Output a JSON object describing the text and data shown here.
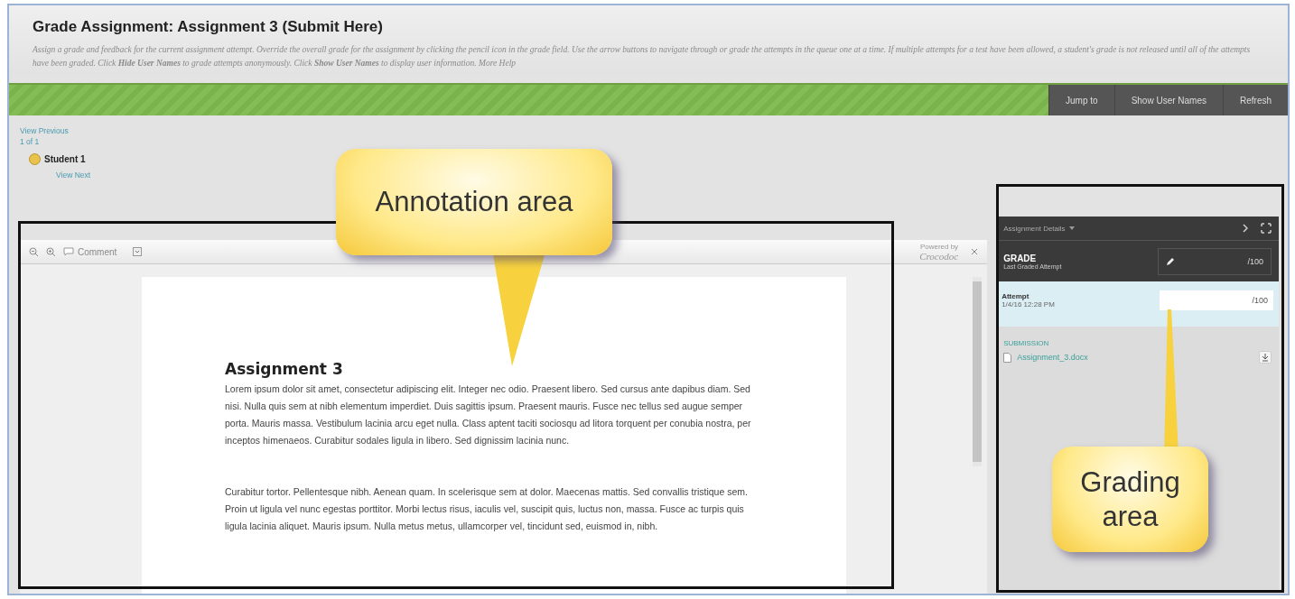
{
  "header": {
    "title": "Grade Assignment: Assignment 3 (Submit Here)",
    "description": "Assign a grade and feedback for the current assignment attempt. Override the overall grade for the assignment by clicking the pencil icon in the grade field. Use the arrow buttons to navigate through or grade the attempts in the queue one at a time. If multiple attempts for a test have been allowed, a student's grade is not released until all of the attempts have been graded. Click **Hide User Names** to grade attempts anonymously. Click **Show User Names** to display user information.",
    "help_link": "More Help"
  },
  "action_bar": {
    "buttons": [
      "Jump to",
      "Show User Names",
      "Refresh"
    ]
  },
  "student_nav": {
    "previous": "View Previous",
    "count": "1 of 1",
    "student": "Student 1",
    "next": "View Next"
  },
  "viewer": {
    "toolbar": {
      "comment": "Comment"
    },
    "branding": {
      "powered_by": "Powered by",
      "logo": "Crocodoc"
    },
    "document": {
      "heading": "Assignment 3",
      "paragraphs": [
        "Lorem ipsum dolor sit amet, consectetur adipiscing elit. Integer nec odio. Praesent libero. Sed cursus ante dapibus diam. Sed nisi. Nulla quis sem at nibh elementum imperdiet. Duis sagittis ipsum. Praesent mauris. Fusce nec tellus sed augue semper porta. Mauris massa. Vestibulum lacinia arcu eget nulla. Class aptent taciti sociosqu ad litora torquent per conubia nostra, per inceptos himenaeos. Curabitur sodales ligula in libero. Sed dignissim lacinia nunc.",
        "Curabitur tortor. Pellentesque nibh. Aenean quam. In scelerisque sem at dolor. Maecenas mattis. Sed convallis tristique sem. Proin ut ligula vel nunc egestas porttitor. Morbi lectus risus, iaculis vel, suscipit quis, luctus non, massa. Fusce ac turpis quis ligula lacinia aliquet. Mauris ipsum. Nulla metus metus, ullamcorper vel, tincidunt sed, euismod in, nibh."
      ]
    }
  },
  "grading_panel": {
    "menu": "Assignment Details",
    "grade": {
      "label": "GRADE",
      "sublabel": "Last Graded Attempt",
      "max": "/100"
    },
    "attempt": {
      "label": "Attempt",
      "date": "1/4/16 12:28 PM",
      "max": "/100"
    },
    "submission": {
      "heading": "SUBMISSION",
      "file": "Assignment_3.docx"
    }
  },
  "callouts": [
    {
      "text": "Annotation area"
    },
    {
      "text": "Grading area"
    }
  ]
}
